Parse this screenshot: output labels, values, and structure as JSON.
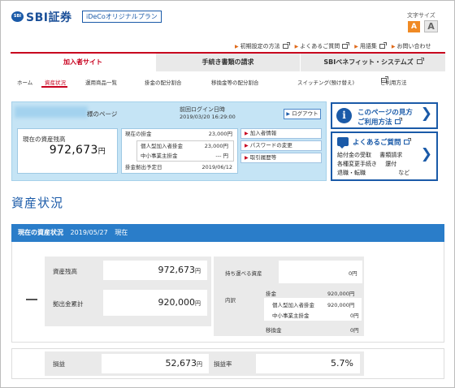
{
  "header": {
    "logo_badge": "SBI",
    "logo_text": "SBI証券",
    "plan_badge": "iDeCoオリジナルプラン",
    "fontsize_label": "文字サイズ",
    "fontsize_small": "A",
    "fontsize_large": "A",
    "util_links": [
      "初期設定の方法",
      "よくあるご質問",
      "用語集",
      "お問い合わせ"
    ]
  },
  "main_nav": {
    "tabs": [
      "加入者サイト",
      "手続き書類の請求",
      "SBIベネフィット・システムズ"
    ]
  },
  "sub_nav": {
    "items": [
      "ホーム",
      "資産状況",
      "運用商品一覧",
      "掛金の配分割合",
      "移換金等の配分割合",
      "スイッチング(預け替え)",
      "ご利用方法"
    ],
    "active_index": 1
  },
  "account": {
    "page_title": "様のページ",
    "last_login_label": "前回ログイン日時",
    "last_login_value": "2019/03/20 16:29:00",
    "logout_label": "ログアウト",
    "asset_label": "現在の資産残高",
    "asset_value": "972,673",
    "asset_unit": "円",
    "contrib_label": "現在の掛金",
    "contrib_value": "23,000円",
    "personal_label": "個人型加入者掛金",
    "personal_value": "23,000円",
    "smb_label": "中小事業主掛金",
    "smb_value": "--- 円",
    "withdraw_label": "掛金拠出予定日",
    "withdraw_value": "2019/06/12",
    "links": [
      "加入者情報",
      "パスワードの変更",
      "取引履歴等"
    ]
  },
  "promo": {
    "guide_icon": "i",
    "guide_line1": "このページの見方",
    "guide_line2": "ご利用方法",
    "faq_title": "よくあるご質問",
    "faq_lines": [
      [
        "給付金の受取",
        "書類請求"
      ],
      [
        "各種変更手続き",
        "還付"
      ],
      [
        "退職・転職",
        "など"
      ]
    ]
  },
  "status": {
    "page_title": "資産状況",
    "section_title": "現在の資産状況",
    "section_date": "2019/05/27",
    "section_suffix": "現在",
    "asset_balance_label": "資産残高",
    "asset_balance_value": "972,673",
    "contrib_total_label": "拠出金累計",
    "contrib_total_value": "920,000",
    "yen": "円",
    "portable_label": "持ち運べる資産",
    "portable_value": "0円",
    "breakdown_label": "内訳",
    "kakekin_label": "掛金",
    "kakekin_value": "920,000円",
    "personal_label": "個人型加入者掛金",
    "personal_value": "920,000円",
    "smb_label": "中小事業主掛金",
    "smb_value": "0円",
    "transfer_label": "移換金",
    "transfer_value": "0円",
    "gain_label": "損益",
    "gain_value": "52,673",
    "gain_rate_label": "損益率",
    "gain_rate_value": "5.7%"
  },
  "colors": {
    "brand_blue": "#1a5aa8",
    "accent_red": "#c8001e",
    "orange": "#f08a24",
    "panel_blue": "#c5e4f5",
    "section_blue": "#2a7dc9"
  }
}
